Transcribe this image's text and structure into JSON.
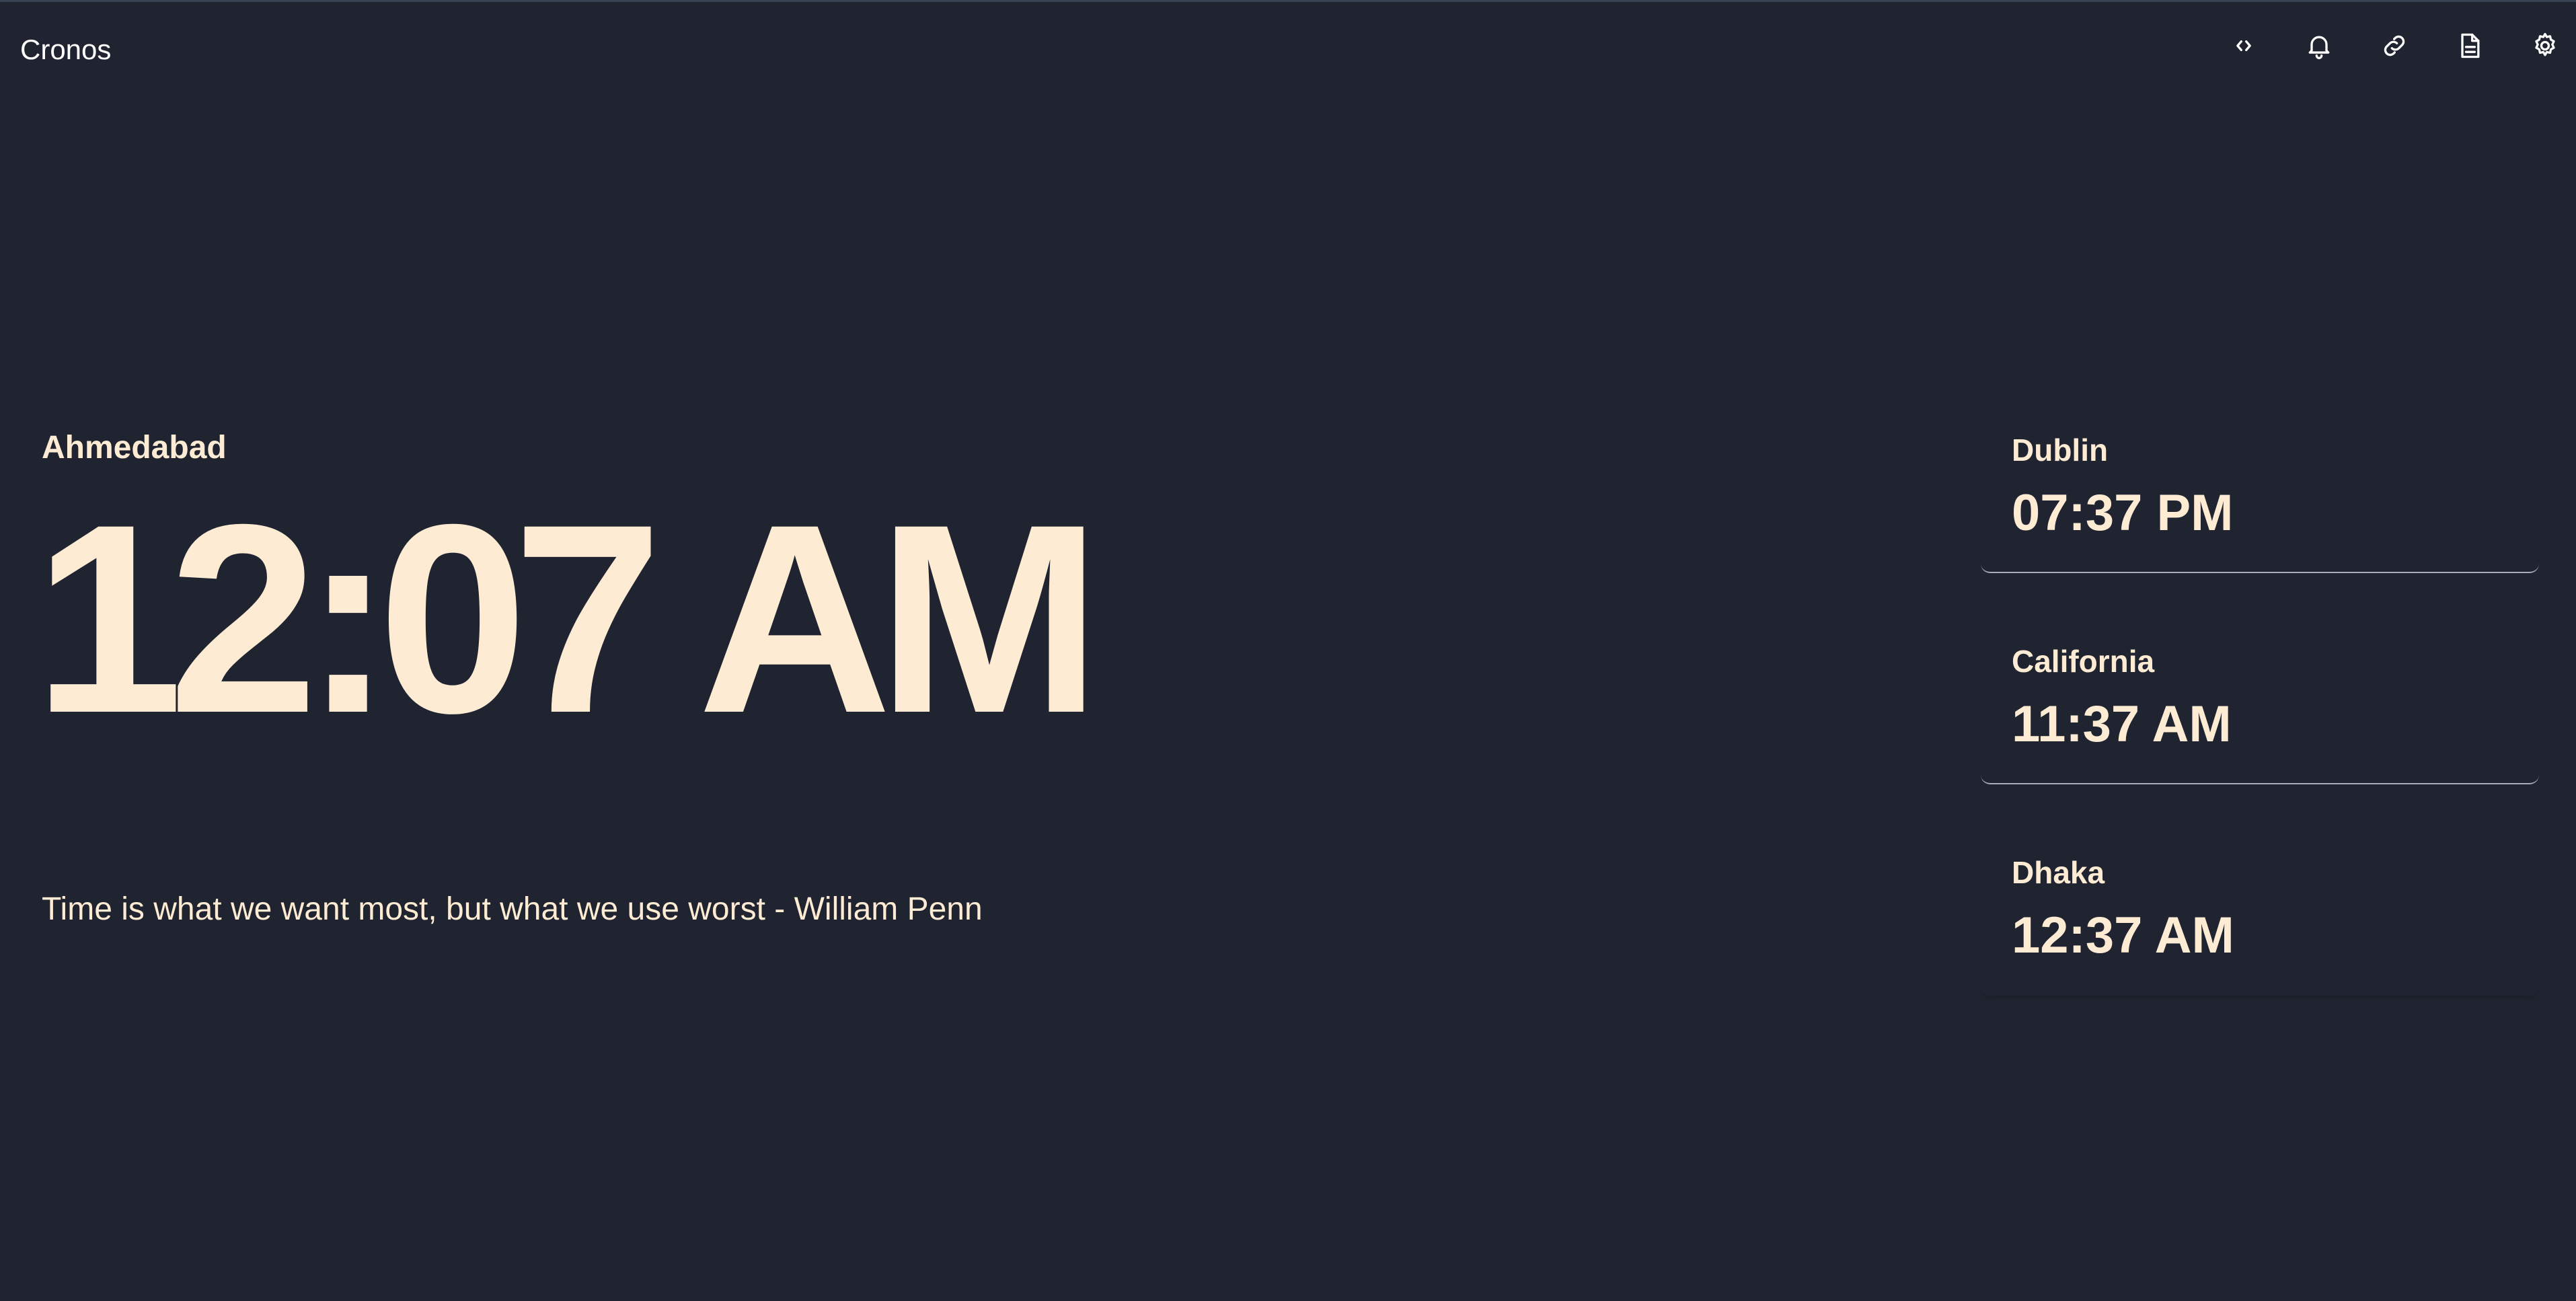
{
  "app": {
    "title": "Cronos"
  },
  "toolbar": {
    "icons": [
      "code-icon",
      "bell-icon",
      "link-icon",
      "document-icon",
      "gear-icon"
    ]
  },
  "main": {
    "city": "Ahmedabad",
    "time": "12:07 AM",
    "quote": "Time is what we want most, but what we use worst - William Penn"
  },
  "zones": [
    {
      "city": "Dublin",
      "time": "07:37 PM"
    },
    {
      "city": "California",
      "time": "11:37 AM"
    },
    {
      "city": "Dhaka",
      "time": "12:37 AM"
    }
  ],
  "colors": {
    "background": "#1f2430",
    "text": "#fdebd3",
    "icon": "#ffffff",
    "divider": "#a7acb6"
  }
}
